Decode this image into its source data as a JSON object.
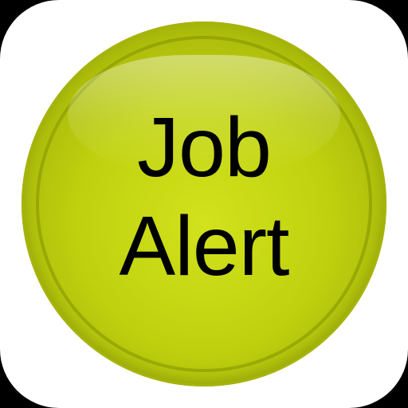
{
  "icon": {
    "line1": "Job",
    "line2": "Alert"
  },
  "colors": {
    "orb": "#c0d20f",
    "orb_edge": "#a6b40a",
    "tile": "#ffffff",
    "text": "#000000"
  }
}
